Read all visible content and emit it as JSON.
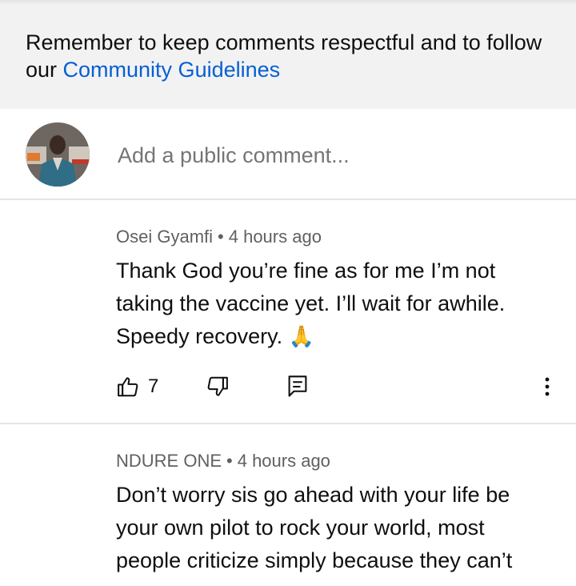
{
  "banner": {
    "text": "Remember to keep comments respectful and to follow our ",
    "link": "Community Guidelines"
  },
  "add_comment": {
    "placeholder": "Add a public comment..."
  },
  "comments": [
    {
      "author": "Osei Gyamfi",
      "separator": "•",
      "time": "4 hours ago",
      "text": "Thank God you’re fine as for me I’m not taking the vaccine yet. I’ll wait for awhile. Speedy recovery. ",
      "emoji": "🙏",
      "likes": "7"
    },
    {
      "author": "NDURE ONE",
      "separator": "•",
      "time": "4 hours ago",
      "text": "Don’t worry sis go ahead with your life be your own pilot to rock your world, most people criticize simply because they can’t"
    }
  ],
  "icons": {
    "like": "thumbs-up-icon",
    "dislike": "thumbs-down-icon",
    "reply": "reply-icon",
    "more": "more-vert-icon"
  },
  "colors": {
    "link": "#065fd4",
    "banner_bg": "#f2f2f2",
    "secondary_text": "#606060"
  }
}
